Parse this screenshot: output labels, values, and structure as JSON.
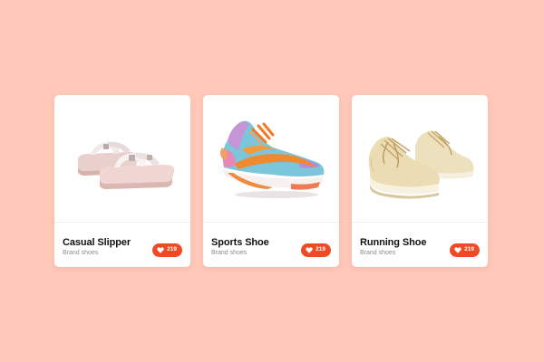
{
  "colors": {
    "background": "#ffc8b8",
    "card": "#ffffff",
    "accent": "#f04a24"
  },
  "products": [
    {
      "title": "Casual Slipper",
      "subtitle": "Brand shoes",
      "likes": "219",
      "icon": "heart-icon",
      "image": "slipper-image"
    },
    {
      "title": "Sports Shoe",
      "subtitle": "Brand shoes",
      "likes": "219",
      "icon": "heart-icon",
      "image": "sports-shoe-image"
    },
    {
      "title": "Running Shoe",
      "subtitle": "Brand shoes",
      "likes": "219",
      "icon": "heart-icon",
      "image": "running-shoe-image"
    }
  ]
}
